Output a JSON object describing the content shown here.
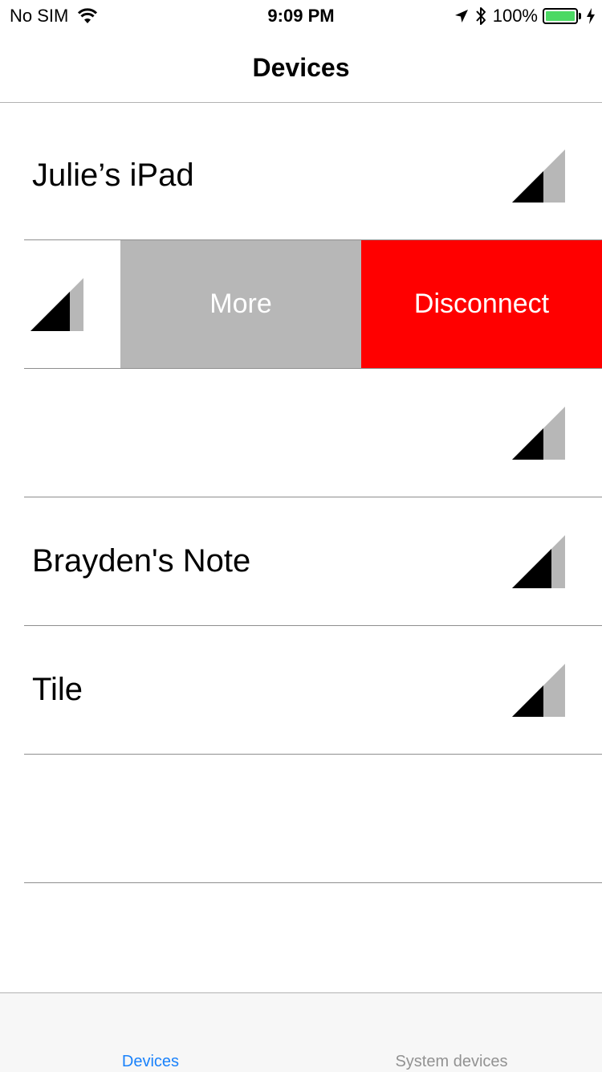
{
  "status_bar": {
    "carrier": "No SIM",
    "time": "9:09 PM",
    "battery": "100%"
  },
  "nav": {
    "title": "Devices"
  },
  "devices": [
    {
      "name": "Julie’s iPad"
    },
    {
      "name": ""
    },
    {
      "name": ""
    },
    {
      "name": "Brayden's Note"
    },
    {
      "name": "Tile"
    }
  ],
  "swipe_actions": {
    "more": "More",
    "disconnect": "Disconnect"
  },
  "tabs": [
    {
      "label": "Devices",
      "selected": true
    },
    {
      "label": "System devices",
      "selected": false
    }
  ],
  "colors": {
    "accent": "#1a82fb",
    "disconnect": "#ff0000",
    "more": "#b7b7b7",
    "battery": "#4cd964"
  }
}
